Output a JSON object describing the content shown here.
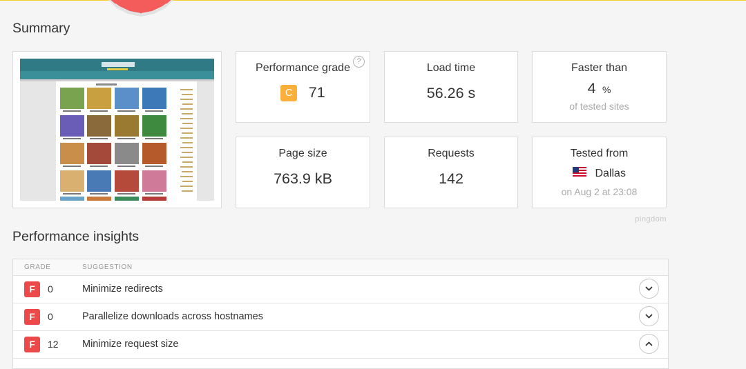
{
  "summary": {
    "title": "Summary",
    "performance_grade": {
      "label": "Performance grade",
      "letter": "C",
      "value": "71",
      "help": "?"
    },
    "load_time": {
      "label": "Load time",
      "value": "56.26 s"
    },
    "faster_than": {
      "label": "Faster than",
      "value": "4",
      "unit": "%",
      "sub": "of tested sites"
    },
    "page_size": {
      "label": "Page size",
      "value": "763.9 kB"
    },
    "requests": {
      "label": "Requests",
      "value": "142"
    },
    "tested_from": {
      "label": "Tested from",
      "location": "Dallas",
      "date": "on Aug 2 at 23:08"
    },
    "brand": "pingdom"
  },
  "insights": {
    "title": "Performance insights",
    "columns": {
      "grade": "GRADE",
      "suggestion": "SUGGESTION"
    },
    "rows": [
      {
        "grade": "F",
        "score": "0",
        "suggestion": "Minimize redirects",
        "expanded": false
      },
      {
        "grade": "F",
        "score": "0",
        "suggestion": "Parallelize downloads across hostnames",
        "expanded": false
      },
      {
        "grade": "F",
        "score": "12",
        "suggestion": "Minimize request size",
        "expanded": true
      }
    ]
  },
  "colors": {
    "grade_c": "#fbb03b",
    "grade_f": "#ed4949",
    "accent_top": "#f2cf2a",
    "badge": "#f45b5b"
  },
  "icons": [
    "help-icon",
    "us-flag-icon",
    "chevron-down-icon",
    "chevron-up-icon"
  ]
}
